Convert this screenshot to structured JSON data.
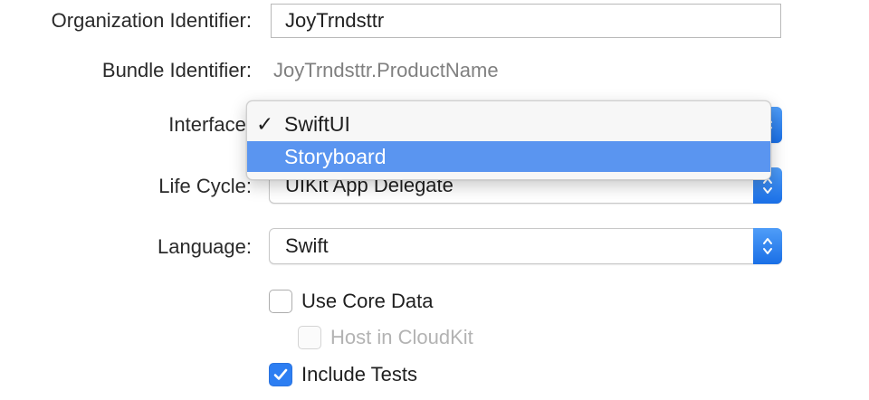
{
  "organization": {
    "label": "Organization Identifier:",
    "value": "JoyTrndsttr"
  },
  "bundle": {
    "label": "Bundle Identifier:",
    "value": "JoyTrndsttr.ProductName"
  },
  "interface": {
    "label": "Interface:",
    "menu_items": [
      {
        "label": "SwiftUI",
        "checked": true,
        "highlighted": false
      },
      {
        "label": "Storyboard",
        "checked": false,
        "highlighted": true
      }
    ]
  },
  "life_cycle": {
    "label": "Life Cycle:",
    "value": "UIKit App Delegate"
  },
  "language": {
    "label": "Language:",
    "value": "Swift"
  },
  "options": {
    "use_core_data": {
      "label": "Use Core Data",
      "checked": false,
      "enabled": true
    },
    "host_in_cloudkit": {
      "label": "Host in CloudKit",
      "checked": false,
      "enabled": false
    },
    "include_tests": {
      "label": "Include Tests",
      "checked": true,
      "enabled": true
    }
  },
  "icons": {
    "check": "checkmark-icon",
    "stepper": "chevron-up-down-icon"
  },
  "colors": {
    "accent": "#2d7ef2",
    "menu_highlight": "#5a95f0"
  }
}
